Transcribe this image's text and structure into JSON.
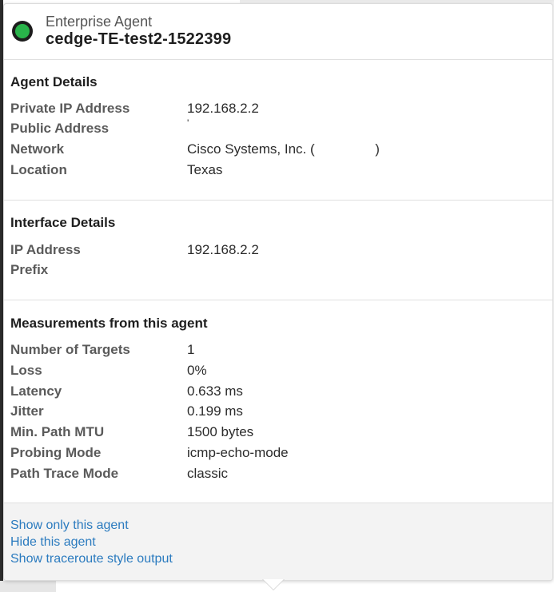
{
  "header": {
    "agent_type": "Enterprise Agent",
    "agent_name": "cedge-TE-test2-1522399",
    "status_color": "#29b34a"
  },
  "agent_details": {
    "title": "Agent Details",
    "rows": [
      {
        "label": "Private IP Address",
        "value": "192.168.2.2"
      },
      {
        "label": "Public Address",
        "value": "'"
      },
      {
        "label": "Network",
        "value": "Cisco Systems, Inc. (                )"
      },
      {
        "label": "Location",
        "value": "Texas"
      }
    ]
  },
  "interface_details": {
    "title": "Interface Details",
    "rows": [
      {
        "label": "IP Address",
        "value": "192.168.2.2"
      },
      {
        "label": "Prefix",
        "value": ""
      }
    ]
  },
  "measurements": {
    "title": "Measurements from this agent",
    "rows": [
      {
        "label": "Number of Targets",
        "value": "1"
      },
      {
        "label": "Loss",
        "value": "0%"
      },
      {
        "label": "Latency",
        "value": "0.633 ms"
      },
      {
        "label": "Jitter",
        "value": "0.199 ms"
      },
      {
        "label": "Min. Path MTU",
        "value": "1500 bytes"
      },
      {
        "label": "Probing Mode",
        "value": "icmp-echo-mode"
      },
      {
        "label": "Path Trace Mode",
        "value": "classic"
      }
    ]
  },
  "actions": {
    "show_only": "Show only this agent",
    "hide": "Hide this agent",
    "traceroute": "Show traceroute style output"
  }
}
